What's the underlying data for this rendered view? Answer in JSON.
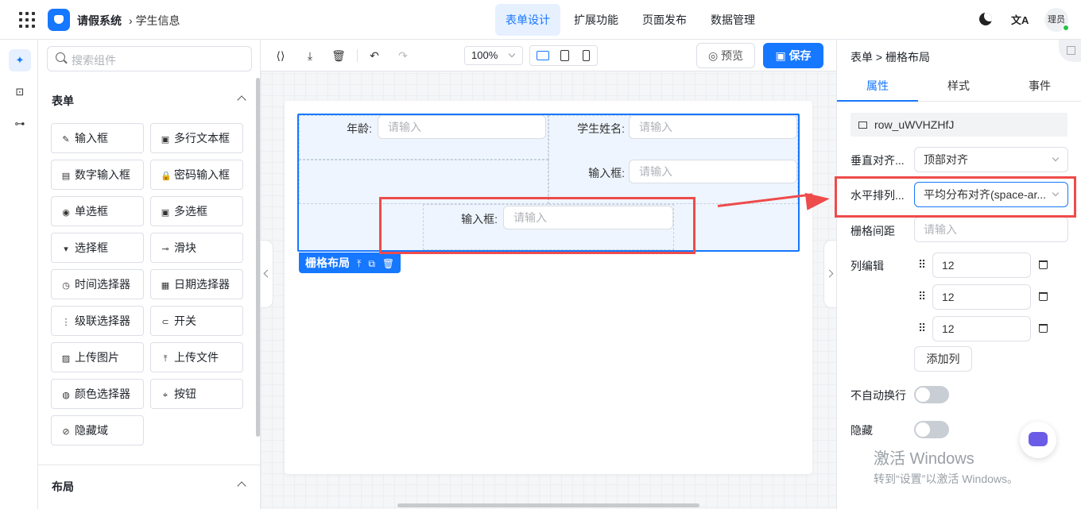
{
  "app": {
    "name": "请假系统",
    "breadcrumb": "学生信息",
    "user": "理员"
  },
  "top_menu": [
    {
      "label": "表单设计",
      "active": true
    },
    {
      "label": "扩展功能",
      "active": false
    },
    {
      "label": "页面发布",
      "active": false
    },
    {
      "label": "数据管理",
      "active": false
    }
  ],
  "top_icons": {
    "theme": "moon-icon",
    "language": "translate-icon",
    "language_glyph": "文A"
  },
  "components": {
    "search_placeholder": "搜索组件",
    "section_form": "表单",
    "section_layout": "布局",
    "items": [
      {
        "label": "输入框",
        "icon": "✎"
      },
      {
        "label": "多行文本框",
        "icon": "▣"
      },
      {
        "label": "数字输入框",
        "icon": "▤"
      },
      {
        "label": "密码输入框",
        "icon": "🔒"
      },
      {
        "label": "单选框",
        "icon": "◉"
      },
      {
        "label": "多选框",
        "icon": "▣"
      },
      {
        "label": "选择框",
        "icon": "▾"
      },
      {
        "label": "滑块",
        "icon": "⊸"
      },
      {
        "label": "时间选择器",
        "icon": "◷"
      },
      {
        "label": "日期选择器",
        "icon": "▦"
      },
      {
        "label": "级联选择器",
        "icon": "⋮"
      },
      {
        "label": "开关",
        "icon": "⊂"
      },
      {
        "label": "上传图片",
        "icon": "▨"
      },
      {
        "label": "上传文件",
        "icon": "⤒"
      },
      {
        "label": "颜色选择器",
        "icon": "◍"
      },
      {
        "label": "按钮",
        "icon": "⌖"
      },
      {
        "label": "隐藏域",
        "icon": "⊘"
      }
    ]
  },
  "toolbar": {
    "zoom": "100%",
    "preview_label": "预览",
    "save_label": "保存"
  },
  "form": {
    "age_label": "年龄:",
    "name_label": "学生姓名:",
    "input_label_1": "输入框:",
    "input_label_2": "输入框:",
    "placeholder": "请输入",
    "grid_tag": "栅格布局"
  },
  "props": {
    "breadcrumb": "表单 > 栅格布局",
    "tabs": [
      "属性",
      "样式",
      "事件"
    ],
    "row_id": "row_uWVHZHfJ",
    "vertical_label": "垂直对齐...",
    "vertical_value": "顶部对齐",
    "horizontal_label": "水平排列...",
    "horizontal_value": "平均分布对齐(space-ar...",
    "gutter_label": "栅格间距",
    "gutter_placeholder": "请输入",
    "columns_label": "列编辑",
    "columns": [
      "12",
      "12",
      "12"
    ],
    "add_column": "添加列",
    "nowrap_label": "不自动换行",
    "hidden_label": "隐藏"
  },
  "watermark": {
    "line1": "激活 Windows",
    "line2": "转到“设置”以激活 Windows。"
  },
  "colors": {
    "primary": "#1677ff",
    "annotation": "#ee4b4b"
  }
}
